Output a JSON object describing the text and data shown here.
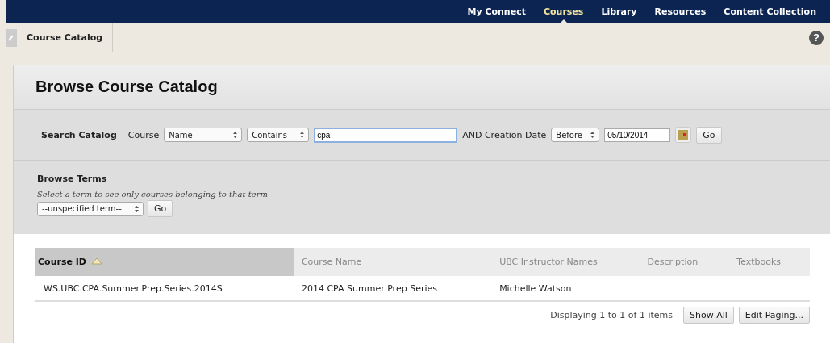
{
  "top_nav": [
    {
      "label": "My Connect",
      "selected": false
    },
    {
      "label": "Courses",
      "selected": true
    },
    {
      "label": "Library",
      "selected": false
    },
    {
      "label": "Resources",
      "selected": false
    },
    {
      "label": "Content Collection",
      "selected": false
    }
  ],
  "breadcrumb": "Course Catalog",
  "help": "?",
  "page_title": "Browse Course Catalog",
  "search": {
    "heading": "Search Catalog",
    "field_label": "Course",
    "field_select": "Name",
    "operator_select": "Contains",
    "value": "cpa",
    "date_label": "AND Creation Date",
    "date_select": "Before",
    "date_value": "05/10/2014",
    "go": "Go"
  },
  "browse_terms": {
    "heading": "Browse Terms",
    "hint": "Select a term to see only courses belonging to that term",
    "term_select": "--unspecified term--",
    "go": "Go"
  },
  "table": {
    "columns": [
      {
        "label": "Course ID",
        "sorted": true
      },
      {
        "label": "Course Name",
        "sorted": false
      },
      {
        "label": "UBC Instructor Names",
        "sorted": false
      },
      {
        "label": "Description",
        "sorted": false
      },
      {
        "label": "Textbooks",
        "sorted": false
      }
    ],
    "rows": [
      [
        "WS.UBC.CPA.Summer.Prep.Series.2014S",
        "2014 CPA Summer Prep Series",
        "Michelle Watson",
        "",
        ""
      ]
    ]
  },
  "paging": {
    "status": "Displaying 1 to 1 of 1 items",
    "buttons": [
      "Show All",
      "Edit Paging..."
    ]
  }
}
